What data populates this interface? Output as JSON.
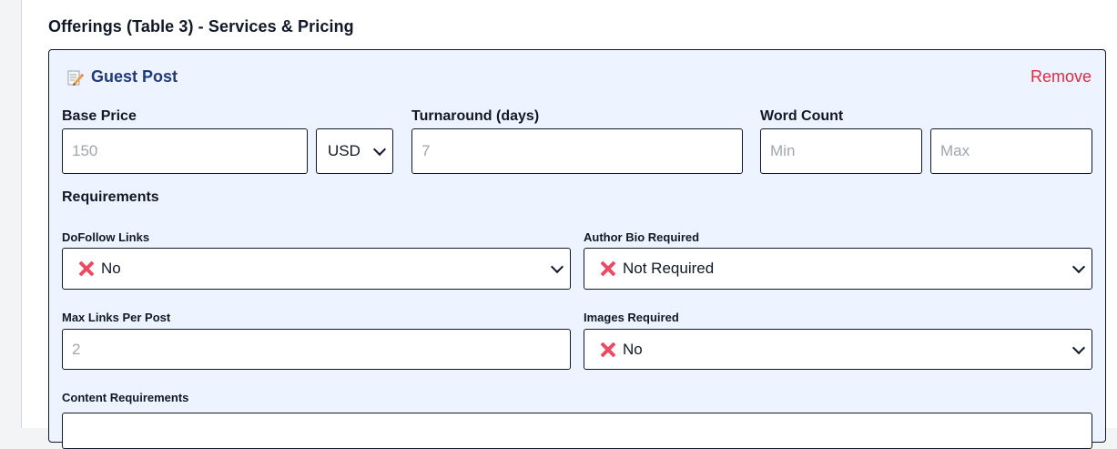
{
  "section": {
    "title": "Offerings (Table 3) - Services & Pricing"
  },
  "offering": {
    "icon": "memo-pencil-icon",
    "title": "Guest Post",
    "remove_label": "Remove"
  },
  "pricing": {
    "base_price_label": "Base Price",
    "base_price_placeholder": "150",
    "currency_value": "USD",
    "turnaround_label": "Turnaround (days)",
    "turnaround_placeholder": "7",
    "word_count_label": "Word Count",
    "word_min_placeholder": "Min",
    "word_max_placeholder": "Max"
  },
  "requirements": {
    "heading": "Requirements",
    "dofollow_label": "DoFollow Links",
    "dofollow_value": "No",
    "author_bio_label": "Author Bio Required",
    "author_bio_value": "Not Required",
    "max_links_label": "Max Links Per Post",
    "max_links_placeholder": "2",
    "images_label": "Images Required",
    "images_value": "No",
    "content_label": "Content Requirements"
  },
  "colors": {
    "accent_title": "#1f3b7a",
    "remove_red": "#dc2a44",
    "cross_red": "#ef4a64",
    "card_bg": "#eef4ff"
  }
}
